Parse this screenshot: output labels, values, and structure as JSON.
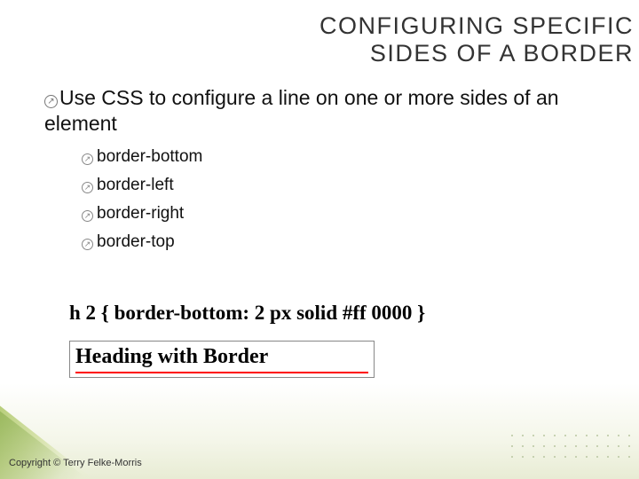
{
  "title_line1": "CONFIGURING SPECIFIC",
  "title_line2": "SIDES OF A BORDER",
  "main_bullet": "Use CSS to configure a line on one or more sides of an element",
  "sub_items": {
    "0": "border-bottom",
    "1": "border-left",
    "2": "border-right",
    "3": "border-top"
  },
  "code_example": "h 2 { border-bottom: 2 px solid #ff 0000 }",
  "example_heading": "Heading with Border",
  "copyright": "Copyright © Terry Felke-Morris"
}
